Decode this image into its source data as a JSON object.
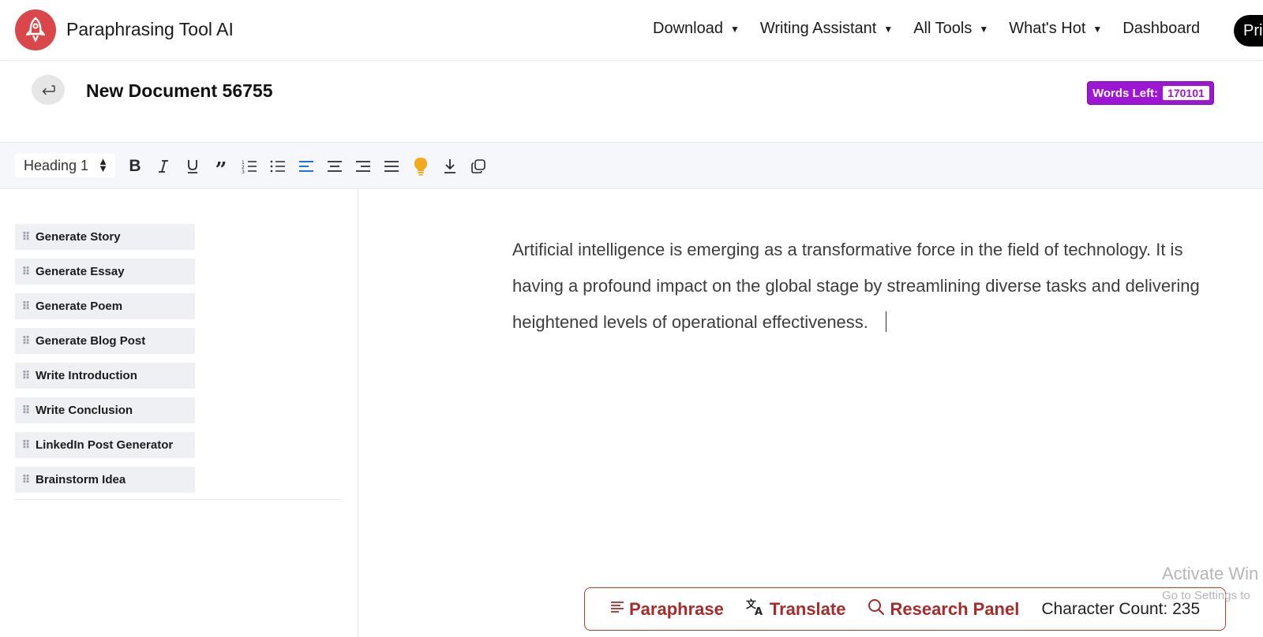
{
  "header": {
    "brand": "Paraphrasing Tool AI",
    "nav": [
      {
        "label": "Download",
        "has_dropdown": true
      },
      {
        "label": "Writing Assistant",
        "has_dropdown": true
      },
      {
        "label": "All Tools",
        "has_dropdown": true
      },
      {
        "label": "What's Hot",
        "has_dropdown": true
      },
      {
        "label": "Dashboard",
        "has_dropdown": false
      }
    ],
    "pricing_label": "Pri"
  },
  "document": {
    "title": "New Document 56755",
    "words_left_label": "Words Left:",
    "words_left_value": "170101"
  },
  "toolbar": {
    "heading_select": "Heading 1",
    "icons": [
      "bold-icon",
      "italic-icon",
      "underline-icon",
      "quote-icon",
      "ordered-list-icon",
      "bullet-list-icon",
      "align-left-icon",
      "align-center-icon",
      "align-right-icon",
      "align-justify-icon",
      "lightbulb-icon",
      "download-icon",
      "copy-icon"
    ]
  },
  "sidebar": {
    "items": [
      {
        "label": "Generate Story"
      },
      {
        "label": "Generate Essay"
      },
      {
        "label": "Generate Poem"
      },
      {
        "label": "Generate Blog Post"
      },
      {
        "label": "Write Introduction"
      },
      {
        "label": "Write Conclusion"
      },
      {
        "label": "LinkedIn Post Generator"
      },
      {
        "label": "Brainstorm Idea"
      }
    ]
  },
  "editor": {
    "lines": [
      "Artificial intelligence is emerging as a transformative force in the field of technology. It is",
      "having a profound impact on the global stage by streamlining diverse tasks and delivering",
      "heightened levels of operational effectiveness."
    ]
  },
  "actions": {
    "paraphrase": "Paraphrase",
    "translate": "Translate",
    "research": "Research Panel",
    "char_count": "Character Count: 235"
  },
  "watermark": {
    "line1": "Activate Win",
    "line2": "Go to Settings to"
  },
  "colors": {
    "brand_red": "#d9474b",
    "action_red": "#a62b2b",
    "badge_purple": "#9d16d6",
    "align_active": "#1a73e8",
    "bulb": "#f4a91c"
  }
}
